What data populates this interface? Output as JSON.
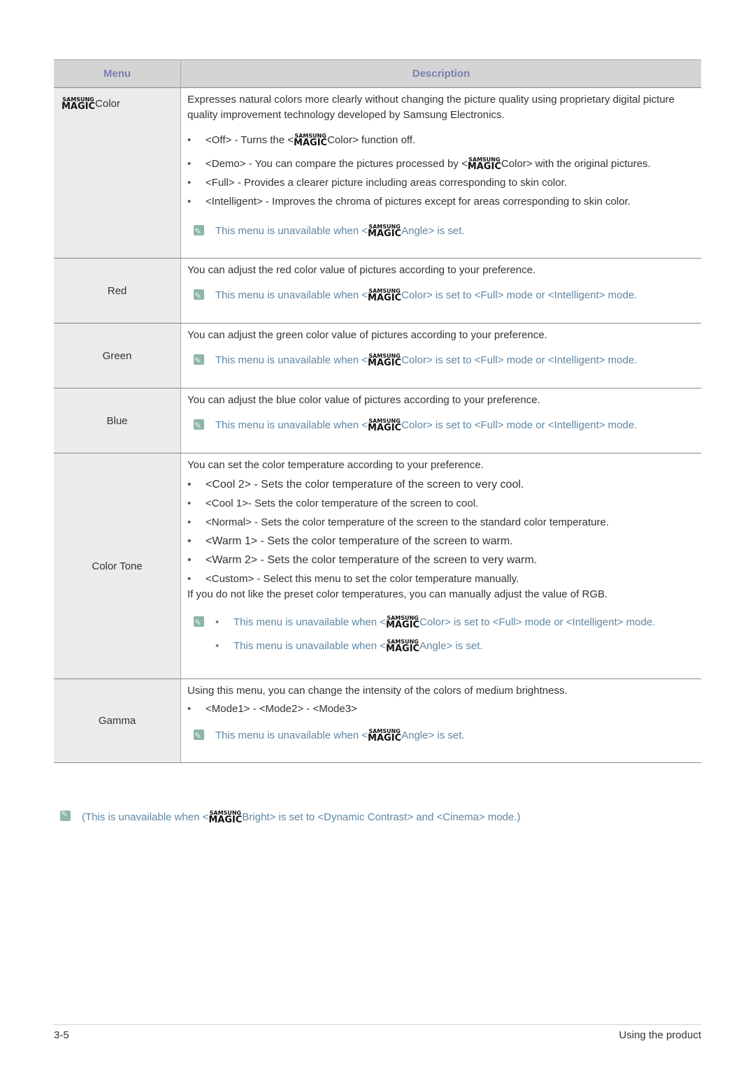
{
  "table": {
    "headers": {
      "menu": "Menu",
      "description": "Description"
    },
    "logo": {
      "top": "SAMSUNG",
      "bottom": "MAGIC"
    },
    "rows": {
      "magic_color": {
        "menu": "Color",
        "intro": "Expresses natural colors more clearly without changing the picture quality using proprietary digital picture quality improvement technology developed by Samsung Electronics.",
        "items": [
          {
            "pre": "<Off> - Turns the <",
            "post": "Color> function off."
          },
          {
            "pre": "<Demo> - You can compare the pictures processed by <",
            "post": "Color> with the original pictures."
          },
          {
            "text": "<Full> - Provides a clearer picture including areas corresponding to skin color."
          },
          {
            "text": "<Intelligent> - Improves the chroma of pictures except for areas corresponding to skin color."
          }
        ],
        "note": {
          "pre": "This menu is unavailable when <",
          "post": "Angle> is set."
        }
      },
      "red": {
        "menu": "Red",
        "desc": "You can adjust the red color value of pictures according to your preference.",
        "note": {
          "pre": "This menu is unavailable when <",
          "post": "Color> is set to <Full> mode or <Intelligent> mode."
        }
      },
      "green": {
        "menu": "Green",
        "desc": "You can adjust the green color value of pictures according to your preference.",
        "note": {
          "pre": "This menu is unavailable when <",
          "post": "Color> is set to <Full> mode or <Intelligent> mode."
        }
      },
      "blue": {
        "menu": "Blue",
        "desc": "You can adjust the blue color value of pictures according to your preference.",
        "note": {
          "pre": "This menu is unavailable when <",
          "post": "Color> is set to <Full> mode or <Intelligent> mode."
        }
      },
      "color_tone": {
        "menu": "Color Tone",
        "desc": "You can set the color temperature according to your preference.",
        "items": [
          "<Cool 2> - Sets the color temperature of the screen to very cool.",
          "<Cool 1>- Sets the color temperature of the screen to cool.",
          "<Normal> - Sets the color temperature of the screen to the standard color temperature.",
          "<Warm 1> - Sets the color temperature of the screen to warm.",
          "<Warm 2> - Sets the color temperature of the screen to very warm.",
          "<Custom> - Select this menu to set the color temperature manually."
        ],
        "extra": "If you do not like the preset color temperatures, you can manually adjust the value of RGB.",
        "notes": [
          {
            "pre": "This menu is unavailable when <",
            "post": "Color> is set to <Full> mode or <Intelligent> mode."
          },
          {
            "pre": "This menu is unavailable when <",
            "post": "Angle> is set."
          }
        ]
      },
      "gamma": {
        "menu": "Gamma",
        "desc": "Using this menu, you can change the intensity of the colors of medium brightness.",
        "items": [
          "<Mode1> - <Mode2> - <Mode3>"
        ],
        "note": {
          "pre": "This menu is unavailable when <",
          "post": "Angle> is set."
        }
      }
    }
  },
  "footnote": {
    "pre": "(This is unavailable when <",
    "post": "Bright> is set to <Dynamic Contrast> and <Cinema> mode.)"
  },
  "footer": {
    "page": "3-5",
    "section": "Using the product"
  }
}
